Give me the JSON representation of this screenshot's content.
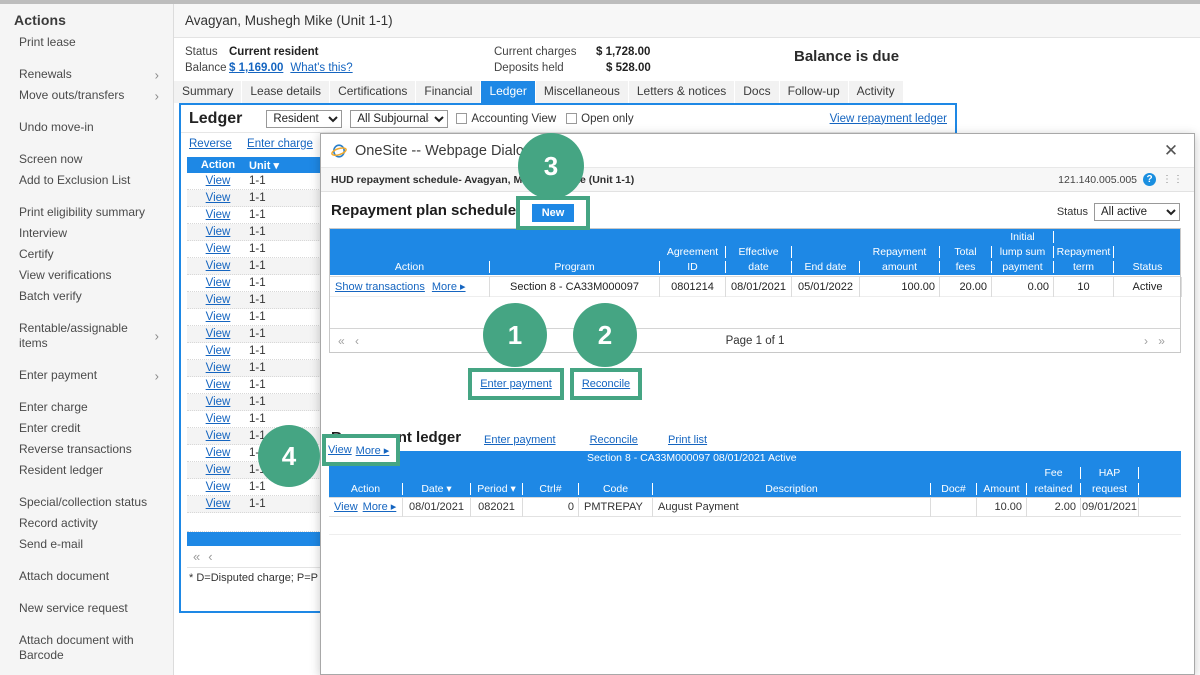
{
  "sidebar": {
    "title": "Actions",
    "items": [
      {
        "label": "Print lease",
        "chevron": false,
        "gap": false
      },
      {
        "label": "Renewals",
        "chevron": true,
        "gap": true
      },
      {
        "label": "Move outs/transfers",
        "chevron": true,
        "gap": false
      },
      {
        "label": "Undo move-in",
        "chevron": false,
        "gap": true
      },
      {
        "label": "Screen now",
        "chevron": false,
        "gap": true
      },
      {
        "label": "Add to Exclusion List",
        "chevron": false,
        "gap": false
      },
      {
        "label": "Print eligibility summary",
        "chevron": false,
        "gap": true
      },
      {
        "label": "Interview",
        "chevron": false,
        "gap": false
      },
      {
        "label": "Certify",
        "chevron": false,
        "gap": false
      },
      {
        "label": "View verifications",
        "chevron": false,
        "gap": false
      },
      {
        "label": "Batch verify",
        "chevron": false,
        "gap": false
      },
      {
        "label": "Rentable/assignable items",
        "chevron": true,
        "gap": true
      },
      {
        "label": "Enter payment",
        "chevron": true,
        "gap": true
      },
      {
        "label": "Enter charge",
        "chevron": false,
        "gap": true
      },
      {
        "label": "Enter credit",
        "chevron": false,
        "gap": false
      },
      {
        "label": "Reverse transactions",
        "chevron": false,
        "gap": false
      },
      {
        "label": "Resident ledger",
        "chevron": false,
        "gap": false
      },
      {
        "label": "Special/collection status",
        "chevron": false,
        "gap": true
      },
      {
        "label": "Record activity",
        "chevron": false,
        "gap": false
      },
      {
        "label": "Send e-mail",
        "chevron": false,
        "gap": false
      },
      {
        "label": "Attach document",
        "chevron": false,
        "gap": true
      },
      {
        "label": "New service request",
        "chevron": false,
        "gap": true
      },
      {
        "label": "Attach document with Barcode",
        "chevron": false,
        "gap": true
      }
    ]
  },
  "header": {
    "resident_name": "Avagyan, Mushegh Mike (Unit 1-1)",
    "status_label": "Status",
    "status_value": "Current resident",
    "balance_label": "Balance",
    "balance_value": "$ 1,169.00",
    "whats_this": "What's this?",
    "current_charges_label": "Current charges",
    "current_charges_value": "$ 1,728.00",
    "deposits_held_label": "Deposits held",
    "deposits_held_value": "$ 528.00",
    "balance_notice": "Balance is due"
  },
  "tabs": [
    {
      "label": "Summary",
      "active": false
    },
    {
      "label": "Lease details",
      "active": false
    },
    {
      "label": "Certifications",
      "active": false
    },
    {
      "label": "Financial",
      "active": false
    },
    {
      "label": "Ledger",
      "active": true
    },
    {
      "label": "Miscellaneous",
      "active": false
    },
    {
      "label": "Letters & notices",
      "active": false
    },
    {
      "label": "Docs",
      "active": false
    },
    {
      "label": "Follow-up",
      "active": false
    },
    {
      "label": "Activity",
      "active": false
    }
  ],
  "ledger_panel": {
    "title": "Ledger",
    "account_select": "Resident",
    "subjournal_select": "All Subjournals",
    "accounting_view_label": "Accounting View",
    "open_only_label": "Open only",
    "view_repayment_ledger_link": "View repayment ledger",
    "reverse_link": "Reverse",
    "enter_charge_link": "Enter charge",
    "columns": [
      "Action",
      "Unit"
    ],
    "rows": [
      {
        "action": "View",
        "unit": "1-1"
      },
      {
        "action": "View",
        "unit": "1-1"
      },
      {
        "action": "View",
        "unit": "1-1"
      },
      {
        "action": "View",
        "unit": "1-1"
      },
      {
        "action": "View",
        "unit": "1-1"
      },
      {
        "action": "View",
        "unit": "1-1"
      },
      {
        "action": "View",
        "unit": "1-1"
      },
      {
        "action": "View",
        "unit": "1-1"
      },
      {
        "action": "View",
        "unit": "1-1"
      },
      {
        "action": "View",
        "unit": "1-1"
      },
      {
        "action": "View",
        "unit": "1-1"
      },
      {
        "action": "View",
        "unit": "1-1"
      },
      {
        "action": "View",
        "unit": "1-1"
      },
      {
        "action": "View",
        "unit": "1-1"
      },
      {
        "action": "View",
        "unit": "1-1"
      },
      {
        "action": "View",
        "unit": "1-1"
      },
      {
        "action": "View",
        "unit": "1-1"
      },
      {
        "action": "View",
        "unit": "1-1"
      },
      {
        "action": "View",
        "unit": "1-1"
      },
      {
        "action": "View",
        "unit": "1-1"
      }
    ],
    "footnote": "* D=Disputed charge; P=P"
  },
  "dialog": {
    "window_title": "OneSite -- Webpage Dialog",
    "close_label": "✕",
    "subtitle": "HUD repayment schedule- Avagyan, Mushegh Mike (Unit 1-1)",
    "version": "121.140.005.005",
    "help_label": "?",
    "plan": {
      "section_title": "Repayment plan schedule",
      "new_button": "New",
      "status_label": "Status",
      "status_value": "All active",
      "columns_top": [
        "",
        "",
        "",
        "",
        "",
        "",
        "",
        "Initial",
        "",
        ""
      ],
      "columns_mid": [
        "",
        "",
        "Agreement",
        "Effective",
        "",
        "Repayment",
        "Total",
        "lump sum",
        "Repayment",
        ""
      ],
      "columns_bottom": [
        "Action",
        "Program",
        "ID",
        "date",
        "End date",
        "amount",
        "fees",
        "payment",
        "term",
        "Status"
      ],
      "rows": [
        {
          "action_show": "Show transactions",
          "action_more": "More",
          "program": "Section 8 - CA33M000097",
          "agreement_id": "0801214",
          "effective_date": "08/01/2021",
          "end_date": "05/01/2022",
          "repayment_amount": "100.00",
          "total_fees": "20.00",
          "initial_lump_sum": "0.00",
          "repayment_term": "10",
          "status": "Active"
        }
      ],
      "page_text": "Page 1 of 1"
    },
    "ledger": {
      "section_title": "Repayment ledger",
      "enter_payment_link": "Enter payment",
      "reconcile_link": "Reconcile",
      "print_list_link": "Print list",
      "banner": "Section 8 - CA33M000097  08/01/2021  Active",
      "columns_top": [
        "",
        "",
        "",
        "",
        "",
        "",
        "",
        "",
        "Fee",
        "HAP"
      ],
      "columns_bottom": [
        "Action",
        "Date",
        "Period",
        "Ctrl#",
        "Code",
        "Description",
        "Doc#",
        "Amount",
        "retained",
        "request"
      ],
      "rows": [
        {
          "action_view": "View",
          "action_more": "More",
          "date": "08/01/2021",
          "period": "082021",
          "ctrl": "0",
          "code": "PMTREPAY",
          "description": "August Payment",
          "doc": "",
          "amount": "10.00",
          "fee_retained": "2.00",
          "hap_request": "09/01/2021"
        }
      ]
    }
  },
  "annotations": [
    {
      "number": "1",
      "target": "enter-payment-link"
    },
    {
      "number": "2",
      "target": "reconcile-link"
    },
    {
      "number": "3",
      "target": "new-button"
    },
    {
      "number": "4",
      "target": "ledger-row-action"
    }
  ],
  "colors": {
    "accent_blue": "#1e88e5",
    "annotation_green": "#45a583",
    "link_blue": "#1565c0"
  }
}
